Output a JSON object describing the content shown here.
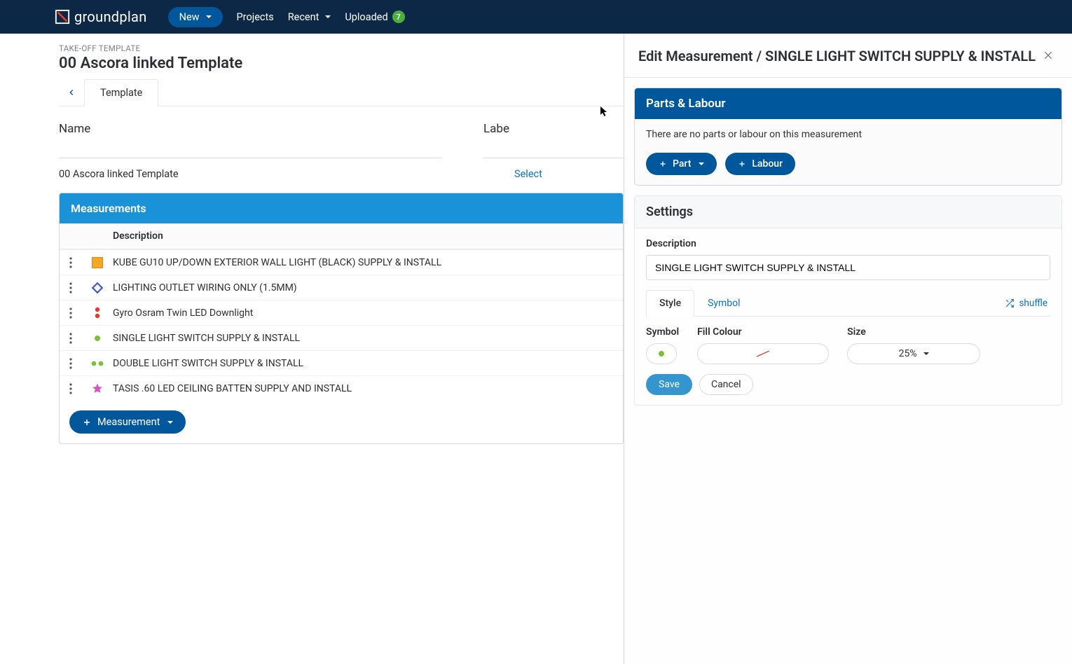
{
  "brand": {
    "name": "groundplan"
  },
  "nav": {
    "new": "New",
    "projects": "Projects",
    "recent": "Recent",
    "uploaded": "Uploaded",
    "uploaded_badge": "7"
  },
  "page": {
    "crumb": "TAKE-OFF TEMPLATE",
    "title": "00 Ascora linked Template",
    "tab": "Template"
  },
  "form": {
    "name_label": "Name",
    "label_label": "Labe",
    "name_value": "00 Ascora linked Template",
    "label_link": "Select"
  },
  "table": {
    "heading": "Measurements",
    "col_desc": "Description",
    "rows": [
      {
        "icon": "square-orange",
        "text": "KUBE GU10 UP/DOWN EXTERIOR WALL LIGHT (BLACK) SUPPLY & INSTALL"
      },
      {
        "icon": "diamond-blue",
        "text": "LIGHTING OUTLET WIRING ONLY (1.5MM)"
      },
      {
        "icon": "dots-red",
        "text": "Gyro Osram Twin LED Downlight"
      },
      {
        "icon": "dot-green",
        "text": "SINGLE LIGHT SWITCH SUPPLY & INSTALL"
      },
      {
        "icon": "dots-green",
        "text": "DOUBLE LIGHT SWITCH SUPPLY & INSTALL"
      },
      {
        "icon": "star-magenta",
        "text": "TASIS .60 LED CEILING BATTEN SUPPLY AND INSTALL"
      }
    ],
    "add_button": "Measurement"
  },
  "panel": {
    "title": "Edit Measurement / SINGLE LIGHT SWITCH SUPPLY & INSTALL",
    "parts": {
      "heading": "Parts & Labour",
      "empty": "There are no parts or labour on this measurement",
      "part": "Part",
      "labour": "Labour"
    },
    "settings": {
      "heading": "Settings",
      "desc_label": "Description",
      "desc_value": "SINGLE LIGHT SWITCH SUPPLY & INSTALL",
      "tab_style": "Style",
      "tab_symbol": "Symbol",
      "shuffle": "shuffle",
      "sym_label": "Symbol",
      "fill_label": "Fill Colour",
      "size_label": "Size",
      "size_value": "25%",
      "save": "Save",
      "cancel": "Cancel"
    }
  }
}
